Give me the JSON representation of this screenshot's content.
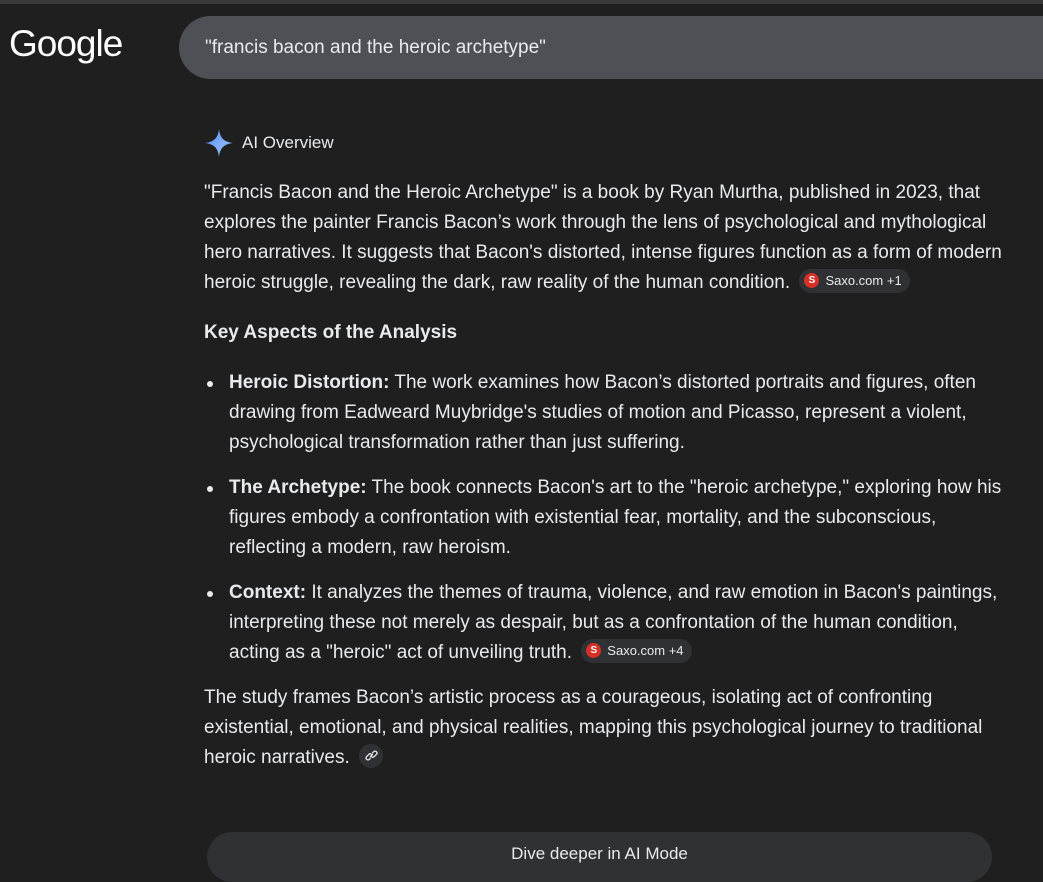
{
  "logo": "Google",
  "search": {
    "query": "\"francis bacon and the heroic archetype\""
  },
  "overview": {
    "title": "AI Overview",
    "intro": "\"Francis Bacon and the Heroic Archetype\" is a book by Ryan Murtha, published in 2023, that explores the painter Francis Bacon’s work through the lens of psychological and mythological hero narratives. It suggests that Bacon's distorted, intense figures function as a form of modern heroic struggle, revealing the dark, raw reality of the human condition.",
    "intro_source": {
      "letter": "S",
      "label": "Saxo.com +1"
    },
    "heading": "Key Aspects of the Analysis",
    "aspects": [
      {
        "term": "Heroic Distortion:",
        "text": " The work examines how Bacon’s distorted portraits and figures, often drawing from Eadweard Muybridge's studies of motion and Picasso, represent a violent, psychological transformation rather than just suffering."
      },
      {
        "term": "The Archetype:",
        "text": " The book connects Bacon's art to the \"heroic archetype,\" exploring how his figures embody a confrontation with existential fear, mortality, and the subconscious, reflecting a modern, raw heroism."
      },
      {
        "term": "Context:",
        "text": " It analyzes the themes of trauma, violence, and raw emotion in Bacon's paintings, interpreting these not merely as despair, but as a confrontation of the human condition, acting as a \"heroic\" act of unveiling truth.",
        "source": {
          "letter": "S",
          "label": "Saxo.com +4"
        }
      }
    ],
    "closing": "The study frames Bacon’s artistic process as a courageous, isolating act of confronting existential, emotional, and physical realities, mapping this psychological journey to traditional heroic narratives.",
    "dive_button": "Dive deeper in AI Mode"
  },
  "colors": {
    "background": "#1f1f1f",
    "searchbar": "#4d5156",
    "chip": "#303134",
    "source_icon": "#d93025",
    "sparkle": "#8ab4f8"
  }
}
